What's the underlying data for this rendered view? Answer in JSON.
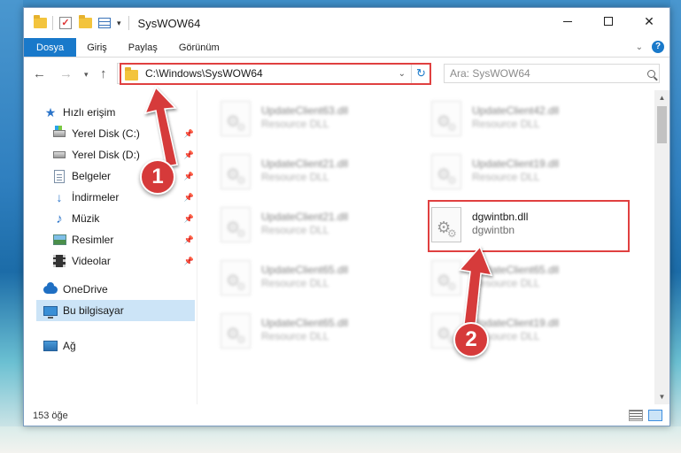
{
  "window": {
    "title": "SysWOW64",
    "controls": {
      "minimize": "",
      "maximize": "",
      "close": "✕"
    }
  },
  "ribbon": {
    "tabs": [
      {
        "label": "Dosya",
        "active": true
      },
      {
        "label": "Giriş"
      },
      {
        "label": "Paylaş"
      },
      {
        "label": "Görünüm"
      }
    ],
    "help": "?"
  },
  "nav": {
    "address": "C:\\Windows\\SysWOW64",
    "search_placeholder": "Ara: SysWOW64"
  },
  "sidebar": {
    "items": [
      {
        "label": "Hızlı erişim",
        "icon": "star-icon"
      },
      {
        "label": "Yerel Disk (C:)",
        "icon": "drive-icon",
        "pinned": true
      },
      {
        "label": "Yerel Disk (D:)",
        "icon": "drive-icon",
        "pinned": true
      },
      {
        "label": "Belgeler",
        "icon": "document-icon",
        "pinned": true
      },
      {
        "label": "İndirmeler",
        "icon": "download-icon",
        "pinned": true
      },
      {
        "label": "Müzik",
        "icon": "music-icon",
        "pinned": true
      },
      {
        "label": "Resimler",
        "icon": "picture-icon",
        "pinned": true
      },
      {
        "label": "Videolar",
        "icon": "video-icon",
        "pinned": true
      },
      {
        "label": "OneDrive",
        "icon": "cloud-icon"
      },
      {
        "label": "Bu bilgisayar",
        "icon": "computer-icon",
        "selected": true
      },
      {
        "label": "Ağ",
        "icon": "network-icon"
      }
    ]
  },
  "files": [
    {
      "name": "UpdateClient63.dll",
      "desc": "Resource DLL"
    },
    {
      "name": "UpdateClient42.dll",
      "desc": "Resource DLL"
    },
    {
      "name": "UpdateClient21.dll",
      "desc": "Resource DLL"
    },
    {
      "name": "UpdateClient19.dll",
      "desc": "Resource DLL"
    },
    {
      "name": "UpdateClient21.dll",
      "desc": "Resource DLL"
    },
    {
      "name": "dgwintbn.dll",
      "desc": "dgwintbn",
      "highlighted": true
    },
    {
      "name": "UpdateClient65.dll",
      "desc": "Resource DLL"
    },
    {
      "name": "UpdateClient65.dll",
      "desc": "Resource DLL"
    },
    {
      "name": "UpdateClient65.dll",
      "desc": "Resource DLL"
    },
    {
      "name": "UpdateClient19.dll",
      "desc": "Resource DLL"
    }
  ],
  "status": {
    "count": "153 öğe"
  },
  "annotations": {
    "badge1": "1",
    "badge2": "2",
    "color": "#d63a3a"
  }
}
